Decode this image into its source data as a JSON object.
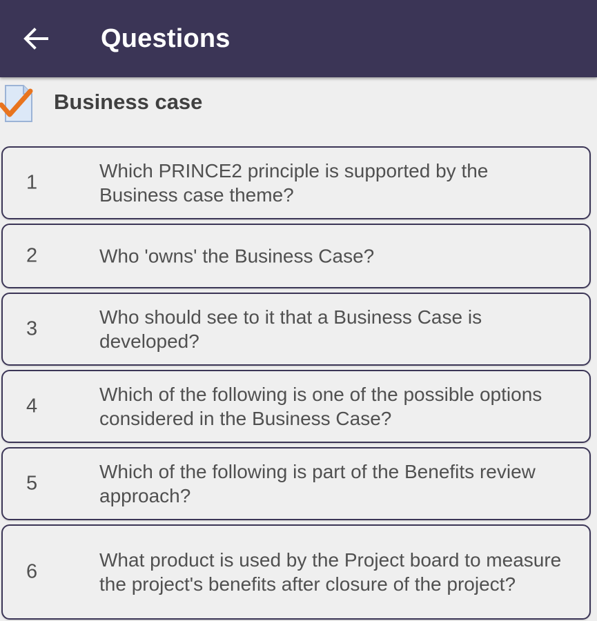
{
  "app_bar": {
    "title": "Questions",
    "back_icon": "arrow-left-icon",
    "color": "#3b3556"
  },
  "section": {
    "title": "Business case",
    "icon": "checked-document-icon",
    "check_color": "#e8741e"
  },
  "questions": [
    {
      "number": "1",
      "text": "Which PRINCE2 principle is supported by the Business case theme?"
    },
    {
      "number": "2",
      "text": "Who 'owns' the Business Case?"
    },
    {
      "number": "3",
      "text": "Who should see to it that a Business Case is developed?"
    },
    {
      "number": "4",
      "text": "Which of the following is one of the possible options considered in the Business Case?"
    },
    {
      "number": "5",
      "text": "Which of the following is part of the Benefits review approach?"
    },
    {
      "number": "6",
      "text": "What product is used by the Project board to measure the project's benefits after closure of the project?"
    }
  ]
}
